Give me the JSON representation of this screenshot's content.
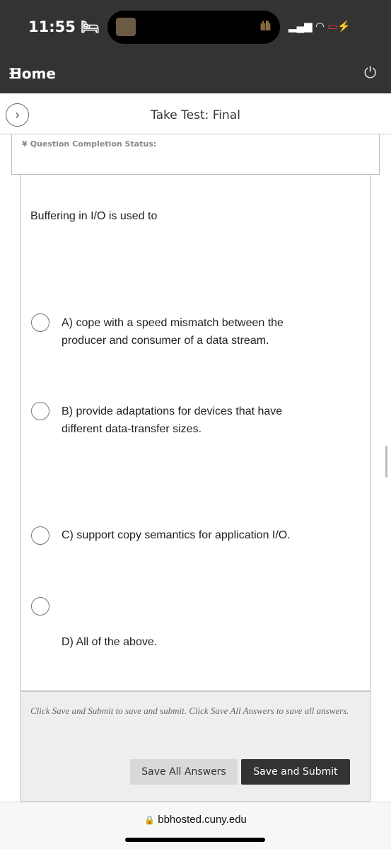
{
  "status_bar": {
    "time": "11:55",
    "sleep_icon": "bed-icon",
    "signal": "signal-icon",
    "wifi": "wifi-icon",
    "battery": "battery-charging-icon"
  },
  "nav": {
    "home_label": "Home",
    "menu_icon": "hamburger-icon",
    "power_icon": "power-icon"
  },
  "header": {
    "title": "Take Test: Final",
    "expand_icon": "chevron-right-icon"
  },
  "completion": {
    "label": "Question Completion Status:"
  },
  "question": {
    "text": "Buffering in I/O is used to",
    "options": [
      {
        "label": "A) cope with a speed mismatch between the producer and consumer of a data stream."
      },
      {
        "label": "B) provide adaptations for devices that have different data-transfer sizes."
      },
      {
        "label": "C) support copy semantics for application I/O."
      },
      {
        "label": "D) All of the above."
      }
    ]
  },
  "footer": {
    "note": "Click Save and Submit to save and submit. Click Save All Answers to save all answers.",
    "save_all": "Save All Answers",
    "save_submit": "Save and Submit"
  },
  "browser": {
    "url": "bbhosted.cuny.edu"
  },
  "colors": {
    "accent": "#1a8a9a",
    "topbar": "#333333"
  }
}
